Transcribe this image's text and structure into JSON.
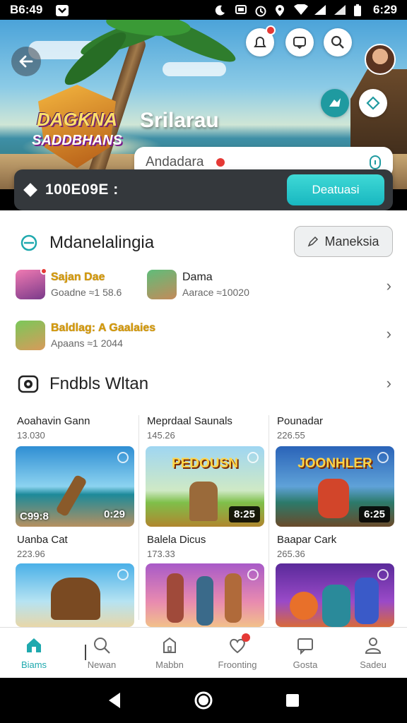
{
  "status_bar": {
    "time_left": "B6:49",
    "time_right": "6:29"
  },
  "hero": {
    "logo_line1": "DAGKNA",
    "logo_line2": "SADDBHANS",
    "title": "Srilarau",
    "search_value": "Andadara"
  },
  "balance": {
    "amount": "100E09E :",
    "cta_label": "Deatuasi"
  },
  "section1": {
    "title": "Mdanelalingia",
    "button_label": "Maneksia"
  },
  "friends": [
    {
      "name": "Sajan Dae",
      "sub": "Goadne ≈1 58.6"
    },
    {
      "name": "Dama",
      "sub": "Aarace ≈10020"
    },
    {
      "name": "Baldlag: A Gaalaies",
      "sub": "Apaans ≈1 2044"
    }
  ],
  "section2": {
    "title": "Fndbls Wltan"
  },
  "cards": [
    {
      "title": "Aoahavin Gann",
      "value": "13.030",
      "badge_left": "C99:8",
      "badge_right": "0:29",
      "label": ""
    },
    {
      "title": "Meprdaal Saunals",
      "value": "145.26",
      "badge_left": "",
      "badge_right": "8:25",
      "label": "PEDOUSN"
    },
    {
      "title": "Pounadar",
      "value": "226.55",
      "badge_left": "",
      "badge_right": "6:25",
      "label": "JOONHLER"
    },
    {
      "title": "Uanba Cat",
      "value": "223.96",
      "badge_left": "",
      "badge_right": "",
      "label": ""
    },
    {
      "title": "Balela Dicus",
      "value": "173.33",
      "badge_left": "",
      "badge_right": "",
      "label": ""
    },
    {
      "title": "Baapar Cark",
      "value": "265.36",
      "badge_left": "",
      "badge_right": "",
      "label": ""
    }
  ],
  "bottom_nav": [
    {
      "label": "Biams",
      "icon": "home-icon",
      "active": true
    },
    {
      "label": "Newan",
      "icon": "search-icon",
      "active": false
    },
    {
      "label": "Mabbn",
      "icon": "bag-icon",
      "active": false
    },
    {
      "label": "Froonting",
      "icon": "heart-icon",
      "active": false
    },
    {
      "label": "Gosta",
      "icon": "chat-icon",
      "active": false
    },
    {
      "label": "Sadeu",
      "icon": "person-icon",
      "active": false
    }
  ],
  "colors": {
    "accent": "#1fa9ae",
    "balance_bg": "#34383c",
    "notif": "#e53935"
  }
}
